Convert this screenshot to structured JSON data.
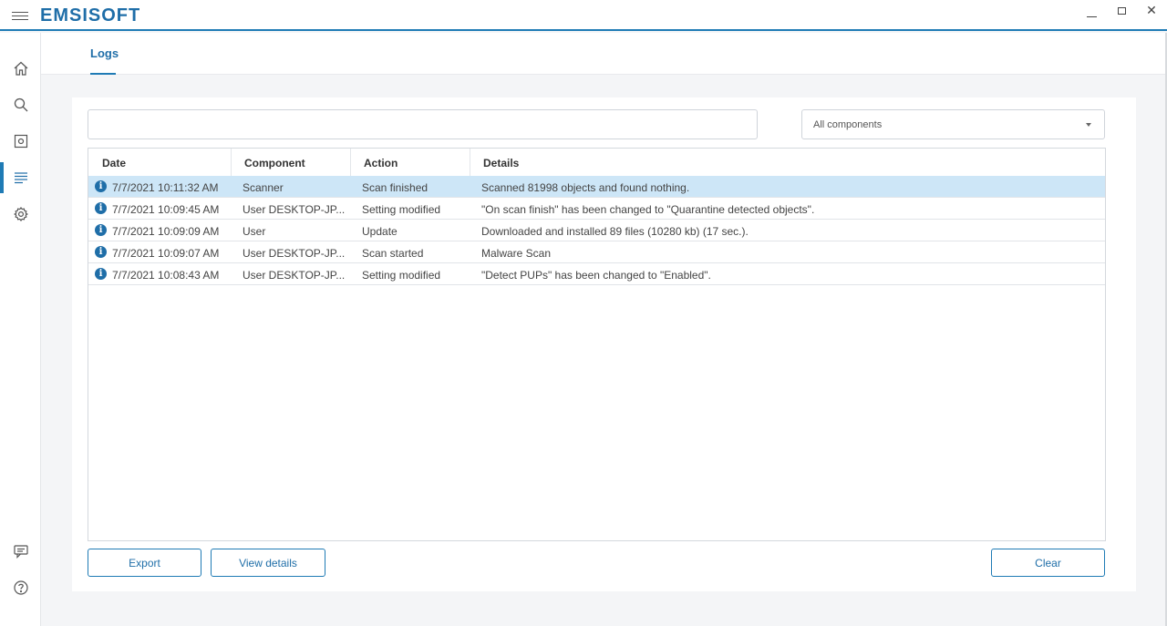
{
  "app": {
    "logo": "EMSISOFT"
  },
  "window": {
    "minimize": "minimize",
    "maximize": "maximize",
    "close": "✕"
  },
  "sidebar": {
    "items": [
      {
        "name": "home",
        "icon": "home-icon"
      },
      {
        "name": "scan",
        "icon": "search-icon"
      },
      {
        "name": "quarantine",
        "icon": "quarantine-icon"
      },
      {
        "name": "logs",
        "icon": "logs-icon",
        "active": true
      },
      {
        "name": "settings",
        "icon": "gear-icon"
      }
    ],
    "bottom": [
      {
        "name": "feedback",
        "icon": "chat-icon"
      },
      {
        "name": "help",
        "icon": "help-icon"
      }
    ]
  },
  "header": {
    "tab": "Logs"
  },
  "filters": {
    "search_value": "",
    "search_placeholder": "",
    "component_selected": "All components"
  },
  "table": {
    "columns": [
      "Date",
      "Component",
      "Action",
      "Details"
    ],
    "rows": [
      {
        "date": "7/7/2021 10:11:32 AM",
        "component": "Scanner",
        "action": "Scan finished",
        "details": "Scanned 81998 objects and found nothing.",
        "selected": true
      },
      {
        "date": "7/7/2021 10:09:45 AM",
        "component": "User DESKTOP-JP...",
        "action": "Setting modified",
        "details": "\"On scan finish\" has been changed to \"Quarantine detected objects\"."
      },
      {
        "date": "7/7/2021 10:09:09 AM",
        "component": "User",
        "action": "Update",
        "details": "Downloaded and installed 89 files (10280 kb) (17 sec.)."
      },
      {
        "date": "7/7/2021 10:09:07 AM",
        "component": "User DESKTOP-JP...",
        "action": "Scan started",
        "details": "Malware Scan"
      },
      {
        "date": "7/7/2021 10:08:43 AM",
        "component": "User DESKTOP-JP...",
        "action": "Setting modified",
        "details": "\"Detect PUPs\" has been changed to \"Enabled\"."
      }
    ]
  },
  "buttons": {
    "export": "Export",
    "view_details": "View details",
    "clear": "Clear"
  },
  "colors": {
    "accent": "#1f7bb5",
    "brand": "#1f6ea8",
    "selected_row": "#cde6f7"
  }
}
